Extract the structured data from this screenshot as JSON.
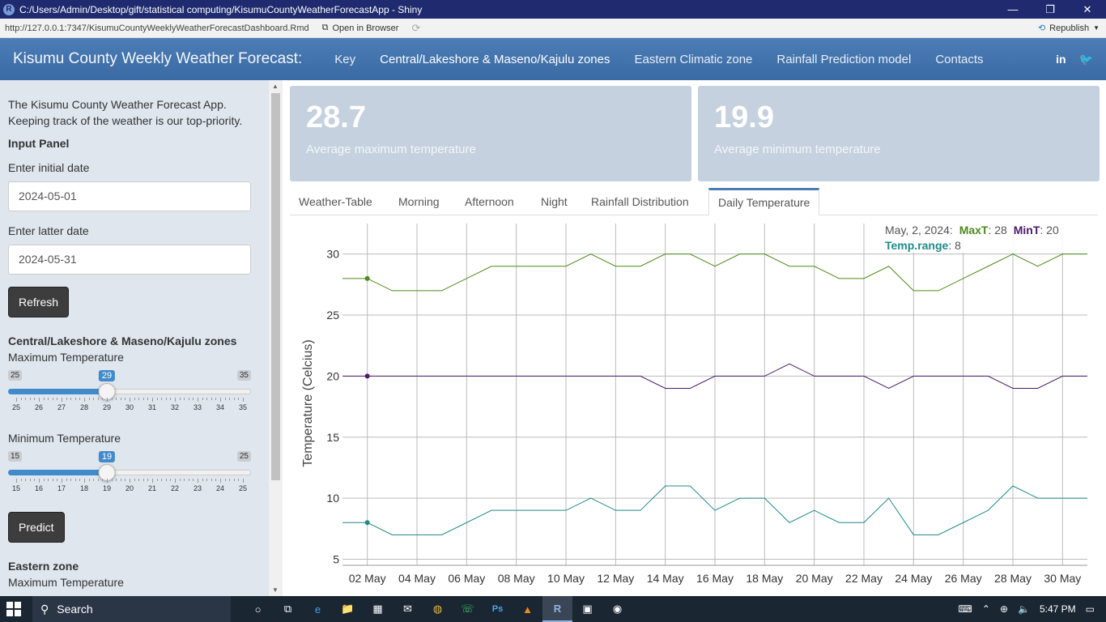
{
  "window": {
    "title": "C:/Users/Admin/Desktop/gift/statistical computing/KisumuCountyWeatherForecastApp - Shiny",
    "controls": [
      "—",
      "❐",
      "✕"
    ]
  },
  "addressbar": {
    "url": "http://127.0.0.1:7347/KisumuCountyWeeklyWeatherForecastDashboard.Rmd",
    "open_in_browser": "Open in Browser",
    "republish": "Republish"
  },
  "navbar": {
    "brand": "Kisumu County Weekly Weather Forecast:",
    "items": [
      {
        "label": "Key",
        "active": false
      },
      {
        "label": "Central/Lakeshore & Maseno/Kajulu zones",
        "active": true
      },
      {
        "label": "Eastern Climatic zone",
        "active": false
      },
      {
        "label": "Rainfall Prediction model",
        "active": false
      },
      {
        "label": "Contacts",
        "active": false
      }
    ],
    "social": [
      "in",
      "🐦"
    ]
  },
  "sidebar": {
    "intro": "The Kisumu County Weather Forecast App. Keeping track of the weather is our top-priority.",
    "input_panel": "Input Panel",
    "initial_date_label": "Enter initial date",
    "initial_date": "2024-05-01",
    "latter_date_label": "Enter latter date",
    "latter_date": "2024-05-31",
    "refresh": "Refresh",
    "central_heading": "Central/Lakeshore & Maseno/Kajulu zones",
    "max_temp_label": "Maximum Temperature",
    "max_slider": {
      "min": "25",
      "max": "35",
      "value": "29",
      "value_num": 29,
      "min_num": 25,
      "max_num": 35,
      "ticks": [
        "25",
        "26",
        "27",
        "28",
        "29",
        "30",
        "31",
        "32",
        "33",
        "34",
        "35"
      ]
    },
    "min_temp_label": "Minimum Temperature",
    "min_slider": {
      "min": "15",
      "max": "25",
      "value": "19",
      "value_num": 19,
      "min_num": 15,
      "max_num": 25,
      "ticks": [
        "15",
        "16",
        "17",
        "18",
        "19",
        "20",
        "21",
        "22",
        "23",
        "24",
        "25"
      ]
    },
    "predict": "Predict",
    "eastern_heading": "Eastern zone",
    "eastern_max_label": "Maximum Temperature"
  },
  "valueboxes": [
    {
      "value": "28.7",
      "label": "Average maximum temperature"
    },
    {
      "value": "19.9",
      "label": "Average minimum temperature"
    }
  ],
  "tabs": [
    {
      "label": "Weather-Table",
      "active": false
    },
    {
      "label": "Morning",
      "active": false
    },
    {
      "label": "Afternoon",
      "active": false
    },
    {
      "label": "Night",
      "active": false
    },
    {
      "label": "Rainfall Distribution",
      "active": false
    },
    {
      "label": "Daily Temperature",
      "active": true
    }
  ],
  "tooltip": {
    "date": "May, 2, 2024:",
    "maxt_label": "MaxT",
    "maxt_value": ": 28",
    "mint_label": "MinT",
    "mint_value": ": 20",
    "range_label": "Temp.range",
    "range_value": ": 8"
  },
  "colors": {
    "maxt": "#4d8a1a",
    "mint": "#4b1a6e",
    "range": "#1f8a8a",
    "navbar": "#4c7db6",
    "slider": "#428bca"
  },
  "chart_data": {
    "type": "line",
    "title": "",
    "xlabel": "",
    "ylabel": "Temperature (Celcius)",
    "ylim": [
      4.5,
      32.5
    ],
    "yticks": [
      5,
      10,
      15,
      20,
      25,
      30
    ],
    "xtick_labels": [
      "02 May",
      "04 May",
      "06 May",
      "08 May",
      "10 May",
      "12 May",
      "14 May",
      "16 May",
      "18 May",
      "20 May",
      "22 May",
      "24 May",
      "26 May",
      "28 May",
      "30 May"
    ],
    "x": [
      1,
      2,
      3,
      4,
      5,
      6,
      7,
      8,
      9,
      10,
      11,
      12,
      13,
      14,
      15,
      16,
      17,
      18,
      19,
      20,
      21,
      22,
      23,
      24,
      25,
      26,
      27,
      28,
      29,
      30,
      31
    ],
    "series": [
      {
        "name": "MaxT",
        "color": "#4d8a1a",
        "values": [
          28,
          28,
          27,
          27,
          27,
          28,
          29,
          29,
          29,
          29,
          30,
          29,
          29,
          30,
          30,
          29,
          30,
          30,
          29,
          29,
          28,
          28,
          29,
          27,
          27,
          28,
          29,
          30,
          29,
          30,
          30
        ]
      },
      {
        "name": "MinT",
        "color": "#4b1a6e",
        "values": [
          20,
          20,
          20,
          20,
          20,
          20,
          20,
          20,
          20,
          20,
          20,
          20,
          20,
          19,
          19,
          20,
          20,
          20,
          21,
          20,
          20,
          20,
          19,
          20,
          20,
          20,
          20,
          19,
          19,
          20,
          20
        ]
      },
      {
        "name": "Temp.range",
        "color": "#1f8a8a",
        "values": [
          8,
          8,
          7,
          7,
          7,
          8,
          9,
          9,
          9,
          9,
          10,
          9,
          9,
          11,
          11,
          9,
          10,
          10,
          8,
          9,
          8,
          8,
          10,
          7,
          7,
          8,
          9,
          11,
          10,
          10,
          10
        ]
      }
    ],
    "highlight_x": 2,
    "grid": true
  },
  "taskbar": {
    "search": "Search",
    "time": "5:47 PM",
    "apps": [
      "○",
      "⧉",
      "e",
      "📁",
      "▦",
      "✉",
      "◍",
      "☏",
      "Ps",
      "▲",
      "R",
      "▣",
      "◉"
    ]
  }
}
